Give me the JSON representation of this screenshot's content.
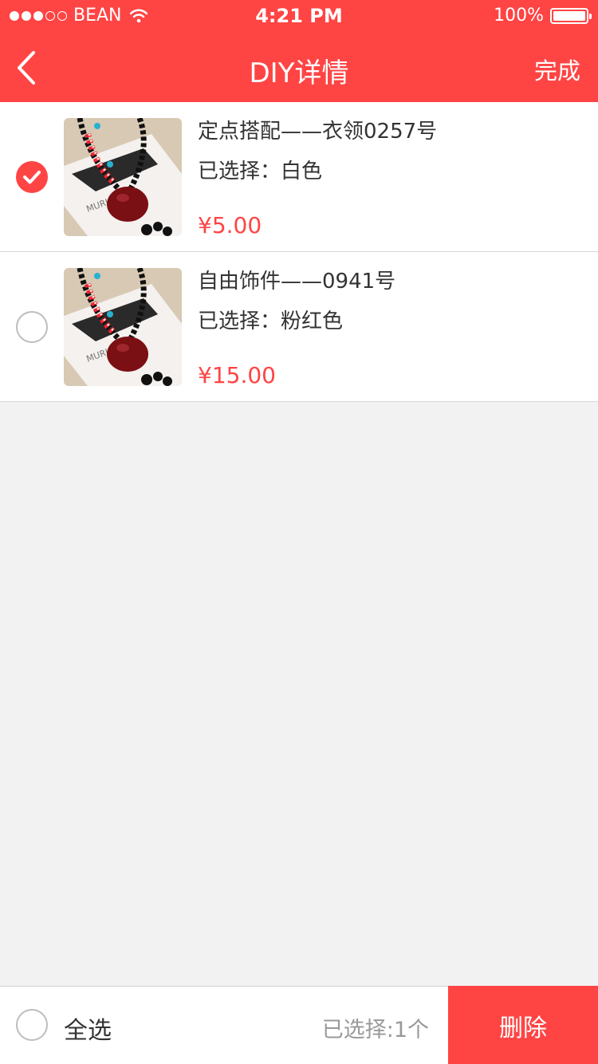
{
  "status_bar": {
    "carrier": "BEAN",
    "time": "4:21 PM",
    "battery": "100%",
    "signal_bars_full": 3
  },
  "nav": {
    "title": "DIY详情",
    "done_label": "完成"
  },
  "items": [
    {
      "title": "定点搭配——衣领0257号",
      "option": "已选择：白色",
      "price": "¥5.00",
      "checked": true,
      "image": "necklace-photo"
    },
    {
      "title": "自由饰件——0941号",
      "option": "已选择：粉红色",
      "price": "¥15.00",
      "checked": false,
      "image": "necklace-photo"
    }
  ],
  "footer": {
    "select_all_label": "全选",
    "selected_count": "已选择:1个",
    "delete_label": "删除"
  },
  "colors": {
    "accent": "#ff4444",
    "text": "#333333",
    "muted": "#999999",
    "background": "#f2f2f2"
  }
}
